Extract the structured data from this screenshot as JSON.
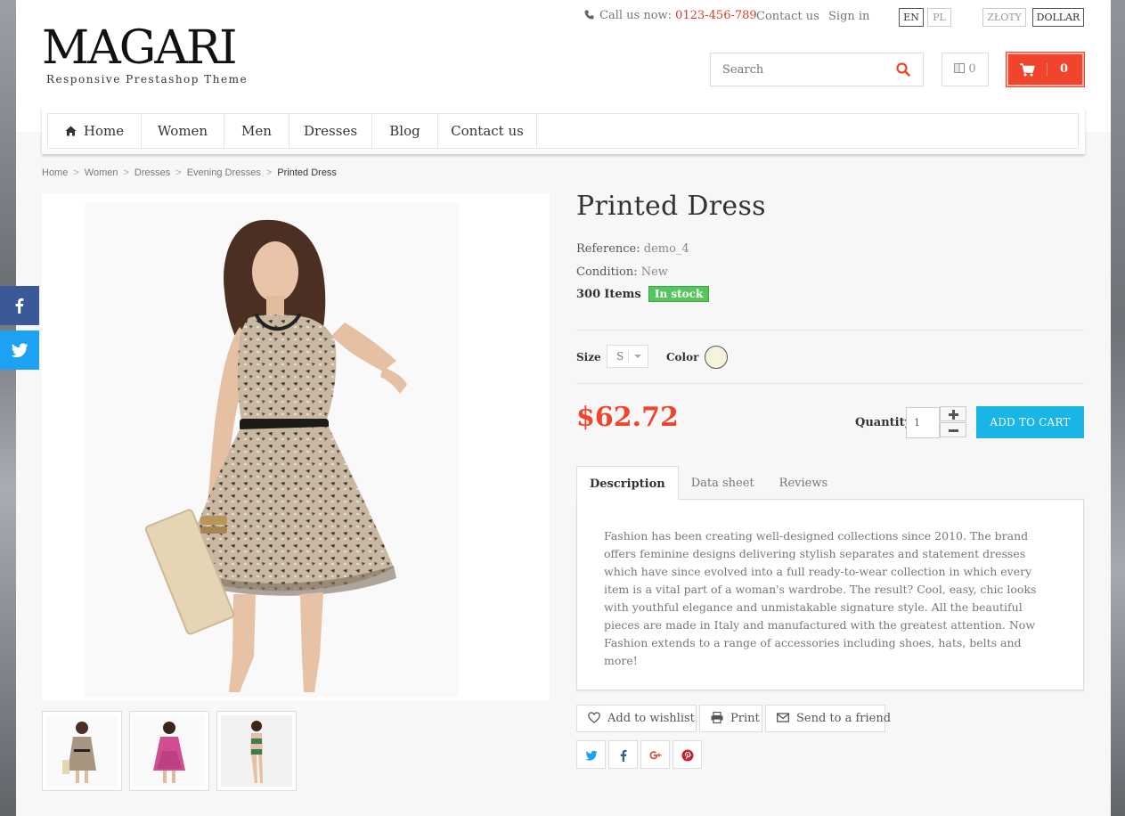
{
  "header": {
    "logo_title": "MAGARI",
    "logo_subtitle": "Responsive Prestashop Theme",
    "call_label": "Call us now:",
    "phone": "0123-456-789",
    "contact_link": "Contact us",
    "signin_link": "Sign in",
    "languages": [
      "EN",
      "PL"
    ],
    "active_language": "EN",
    "currencies": [
      "ZŁOTY",
      "DOLLAR"
    ],
    "active_currency": "DOLLAR",
    "search_placeholder": "Search",
    "compare_count": "0",
    "cart_count": "0",
    "accent_color": "#f0452c"
  },
  "nav": {
    "items": [
      "Home",
      "Women",
      "Men",
      "Dresses",
      "Blog",
      "Contact us"
    ]
  },
  "breadcrumb": [
    "Home",
    "Women",
    "Dresses",
    "Evening Dresses",
    "Printed Dress"
  ],
  "product": {
    "title": "Printed Dress",
    "reference_label": "Reference:",
    "reference": "demo_4",
    "condition_label": "Condition:",
    "condition": "New",
    "quantity_count": "300",
    "items_label": "Items",
    "stock_status": "In stock",
    "size_label": "Size",
    "size_value": "S",
    "color_label": "Color",
    "color_value": "#f6f3dd",
    "price": "$62.72",
    "quantity_label": "Quantity",
    "quantity_value": "1",
    "add_to_cart": "ADD TO CART",
    "thumbnails": [
      "thumb-1",
      "thumb-2",
      "thumb-3"
    ]
  },
  "tabs": {
    "items": [
      "Description",
      "Data sheet",
      "Reviews"
    ],
    "active": "Description",
    "description": "Fashion has been creating well-designed collections since 2010. The brand offers feminine designs delivering stylish separates and statement dresses which have since evolved into a full ready-to-wear collection in which every item is a vital part of a woman's wardrobe. The result? Cool, easy, chic looks with youthful elegance and unmistakable signature style. All the beautiful pieces are made in Italy and manufactured with the greatest attention. Now Fashion extends to a range of accessories including shoes, hats, belts and more!"
  },
  "actions": {
    "wishlist": "Add to wishlist",
    "print": "Print",
    "send_friend": "Send to a friend"
  },
  "share": [
    "twitter-icon",
    "facebook-icon",
    "google-plus-icon",
    "pinterest-icon"
  ],
  "side_social": [
    "facebook-icon",
    "twitter-icon"
  ]
}
